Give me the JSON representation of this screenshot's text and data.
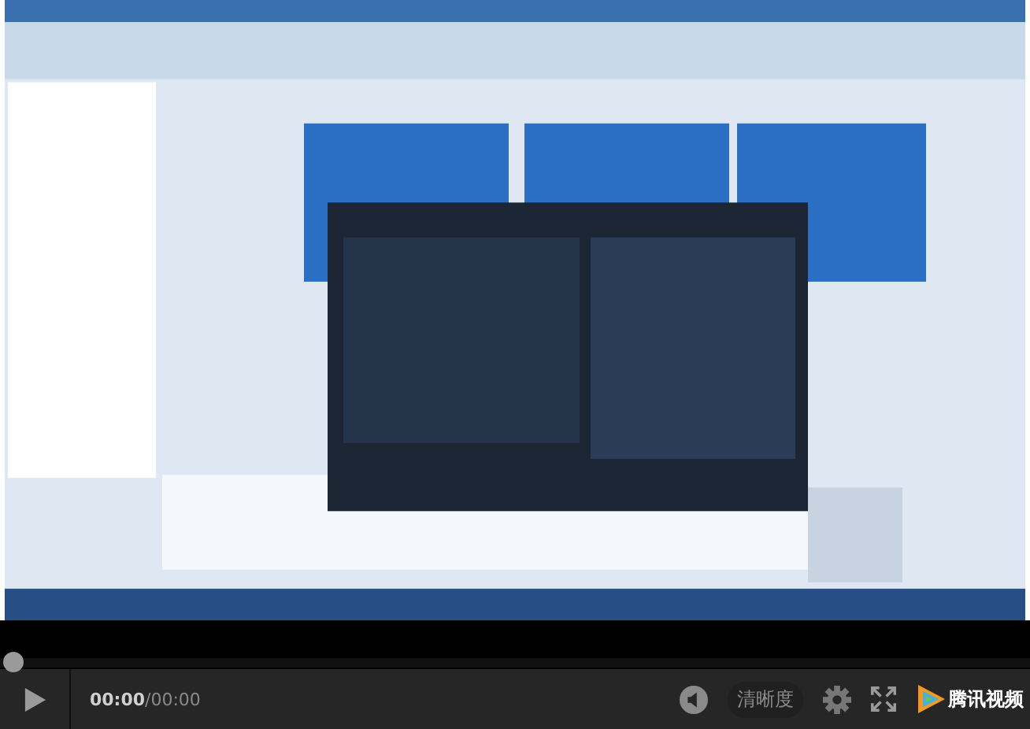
{
  "player": {
    "progress": {
      "level": 0
    },
    "time_current": "00:00",
    "time_total": "/00:00",
    "quality_label": "清晰度",
    "logo_text": "腾讯视频"
  }
}
